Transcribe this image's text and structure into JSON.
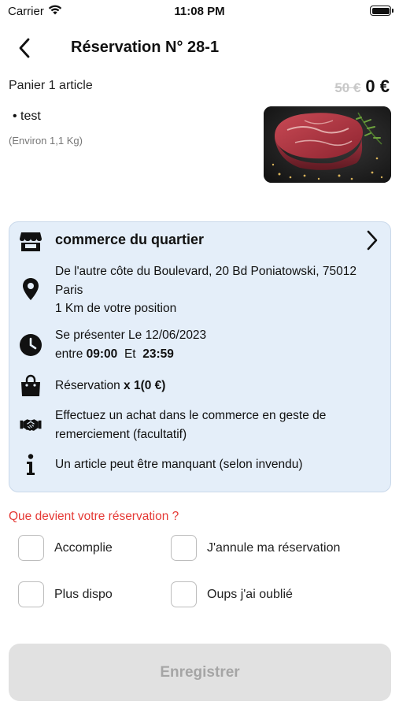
{
  "status_bar": {
    "carrier": "Carrier",
    "time": "11:08 PM"
  },
  "header": {
    "title": "Réservation N° 28-1"
  },
  "cart": {
    "label": "Panier 1 article",
    "old_price": "50 €",
    "new_price": "0 €",
    "item_name": "• test",
    "item_weight": "(Environ 1,1 Kg)"
  },
  "store": {
    "name": "commerce du quartier",
    "address_line1": "De l'autre côte du Boulevard, 20 Bd Poniatowski, 75012",
    "address_line2": "Paris",
    "distance": "1 Km  de votre position",
    "pickup_line1": "Se présenter Le 12/06/2023",
    "pickup_between": "entre",
    "pickup_start": "09:00",
    "pickup_and": "Et",
    "pickup_end": "23:59",
    "reservation_prefix": "Réservation",
    "reservation_count": "x 1(0 €)",
    "thanks_line1": "Effectuez un achat dans le commerce en geste de",
    "thanks_line2": "remerciement (facultatif)",
    "info": "Un article peut être manquant (selon invendu)"
  },
  "question": {
    "label": "Que devient votre réservation ?",
    "options": [
      "Accomplie",
      "J'annule ma réservation",
      "Plus dispo",
      "Oups j'ai oublié"
    ]
  },
  "save_label": "Enregistrer",
  "colors": {
    "card_bg": "#e4eef9",
    "question_red": "#e53935",
    "button_disabled_bg": "#e1e1e1",
    "button_disabled_text": "#a5a5a5",
    "old_price_gray": "#c8c8c8"
  },
  "icons": [
    "wifi-icon",
    "battery-icon",
    "back-arrow-icon",
    "store-icon",
    "chevron-right-icon",
    "location-pin-icon",
    "clock-icon",
    "shopping-bag-icon",
    "handshake-icon",
    "info-icon"
  ]
}
